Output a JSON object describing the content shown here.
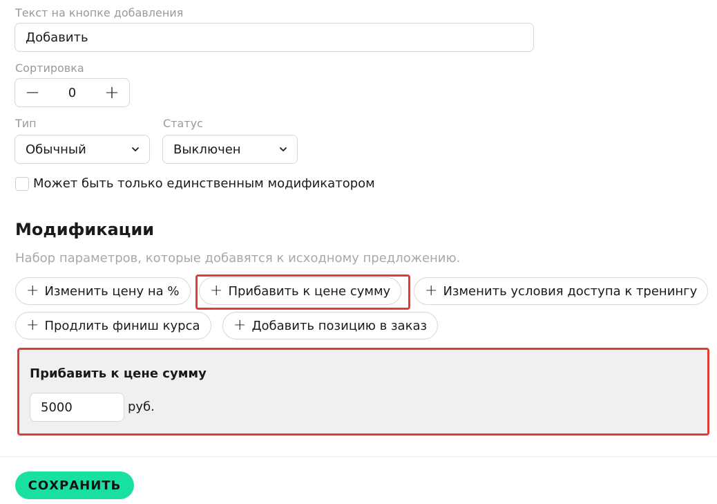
{
  "form": {
    "add_button_text": {
      "label": "Текст на кнопке добавления",
      "value": "Добавить"
    },
    "sort": {
      "label": "Сортировка",
      "value": "0",
      "minus": "−",
      "plus": "+"
    },
    "type": {
      "label": "Тип",
      "value": "Обычный"
    },
    "status": {
      "label": "Статус",
      "value": "Выключен"
    },
    "single_modifier": {
      "label": "Может быть только единственным модификатором",
      "checked": false
    }
  },
  "modifications": {
    "title": "Модификации",
    "subtitle": "Набор параметров, которые добавятся к исходному предложению.",
    "plus_glyph": "+",
    "chips": [
      {
        "label": "Изменить цену на %"
      },
      {
        "label": "Прибавить к цене сумму",
        "selected": true
      },
      {
        "label": "Изменить условия доступа к тренингу"
      },
      {
        "label": "Продлить финиш курса"
      },
      {
        "label": "Добавить позицию в заказ"
      }
    ],
    "panel": {
      "title": "Прибавить к цене сумму",
      "value": "5000",
      "unit": "руб."
    }
  },
  "footer": {
    "save_label": "СОХРАНИТЬ"
  },
  "colors": {
    "accent": "#19e0a0",
    "highlight": "#e03c31",
    "muted_text": "#9a9a9a"
  }
}
